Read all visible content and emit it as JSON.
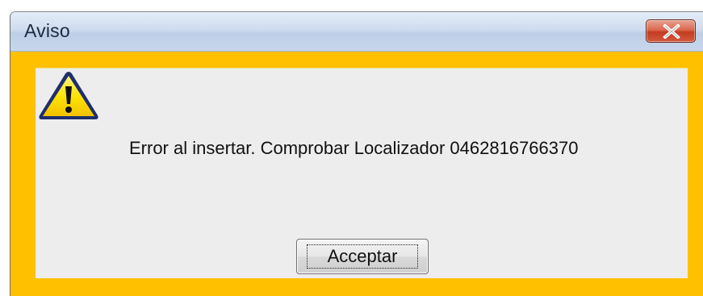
{
  "window": {
    "title": "Aviso",
    "close_icon": "close-x-icon",
    "accent_color": "#ffc000",
    "close_color": "#c94a2e"
  },
  "dialog": {
    "icon": "warning-icon",
    "message": "Error al insertar. Comprobar Localizador 0462816766370",
    "ok_label": "Acceptar"
  }
}
